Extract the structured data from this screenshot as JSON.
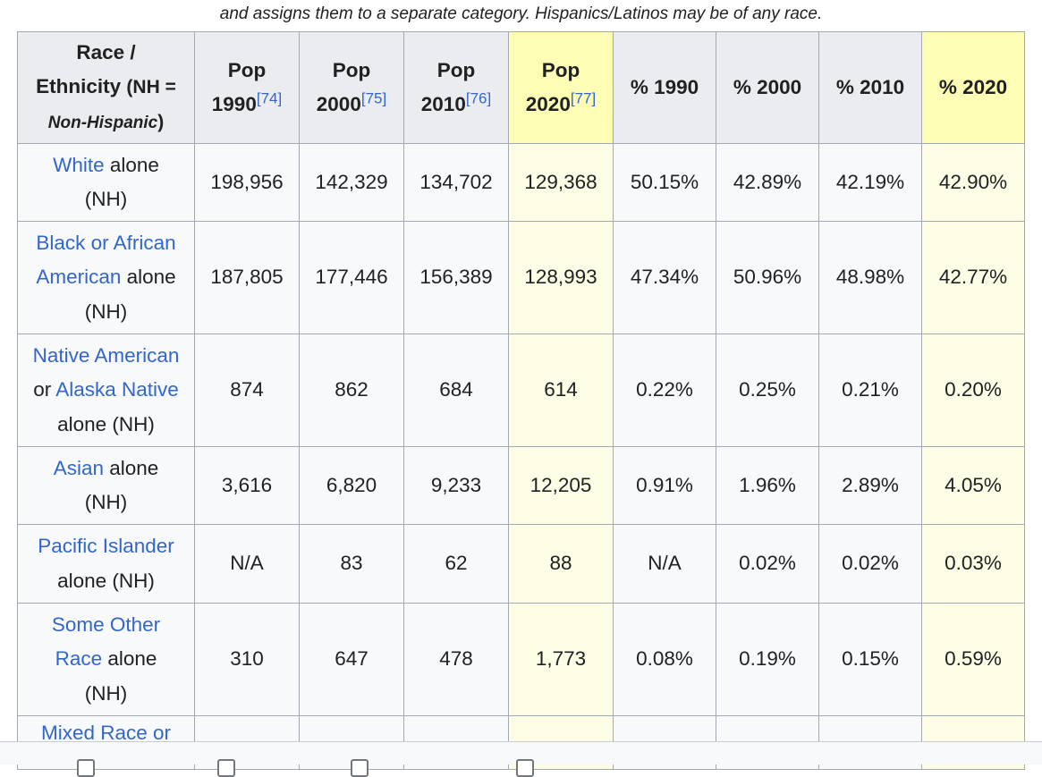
{
  "caption": "and assigns them to a separate category. Hispanics/Latinos may be of any race.",
  "header": {
    "race_title": "Race /",
    "ethnicity_word": "Ethnicity",
    "nh_note": "(NH =",
    "non_hispanic": "Non-Hispanic",
    "close_paren": ")",
    "columns": [
      {
        "label": "Pop",
        "year": "1990",
        "ref": "[74]"
      },
      {
        "label": "Pop",
        "year": "2000",
        "ref": "[75]"
      },
      {
        "label": "Pop",
        "year": "2010",
        "ref": "[76]"
      },
      {
        "label": "Pop",
        "year": "2020",
        "ref": "[77]"
      }
    ],
    "pct_columns": [
      "% 1990",
      "% 2000",
      "% 2010",
      "% 2020"
    ]
  },
  "rows": [
    {
      "link1": "White",
      "mid": " alone",
      "tail": "(NH)",
      "values": [
        "198,956",
        "142,329",
        "134,702",
        "129,368",
        "50.15%",
        "42.89%",
        "42.19%",
        "42.90%"
      ]
    },
    {
      "link1": "Black or African",
      "link2": "American",
      "mid": " alone",
      "tail": "(NH)",
      "values": [
        "187,805",
        "177,446",
        "156,389",
        "128,993",
        "47.34%",
        "50.96%",
        "48.98%",
        "42.77%"
      ]
    },
    {
      "link1": "Native American",
      "pre2": "or ",
      "link2": "Alaska Native",
      "tail": "alone (NH)",
      "values": [
        "874",
        "862",
        "684",
        "614",
        "0.22%",
        "0.25%",
        "0.21%",
        "0.20%"
      ]
    },
    {
      "link1": "Asian",
      "mid": " alone",
      "tail": "(NH)",
      "values": [
        "3,616",
        "6,820",
        "9,233",
        "12,205",
        "0.91%",
        "1.96%",
        "2.89%",
        "4.05%"
      ]
    },
    {
      "link1": "Pacific Islander",
      "tail": "alone (NH)",
      "values": [
        "N/A",
        "83",
        "62",
        "88",
        "N/A",
        "0.02%",
        "0.02%",
        "0.03%"
      ]
    },
    {
      "link1": "Some Other",
      "link2": "Race",
      "mid": " alone",
      "tail": "(NH)",
      "values": [
        "310",
        "647",
        "478",
        "1,773",
        "0.08%",
        "0.19%",
        "0.15%",
        "0.59%"
      ]
    },
    {
      "link1": "Mixed Race or",
      "values": [
        "",
        "",
        "",
        "",
        "",
        "",
        "",
        ""
      ]
    }
  ],
  "colors": {
    "highlight": "#fefeb8",
    "link": "#3366cc",
    "border": "#a2a9b1"
  }
}
